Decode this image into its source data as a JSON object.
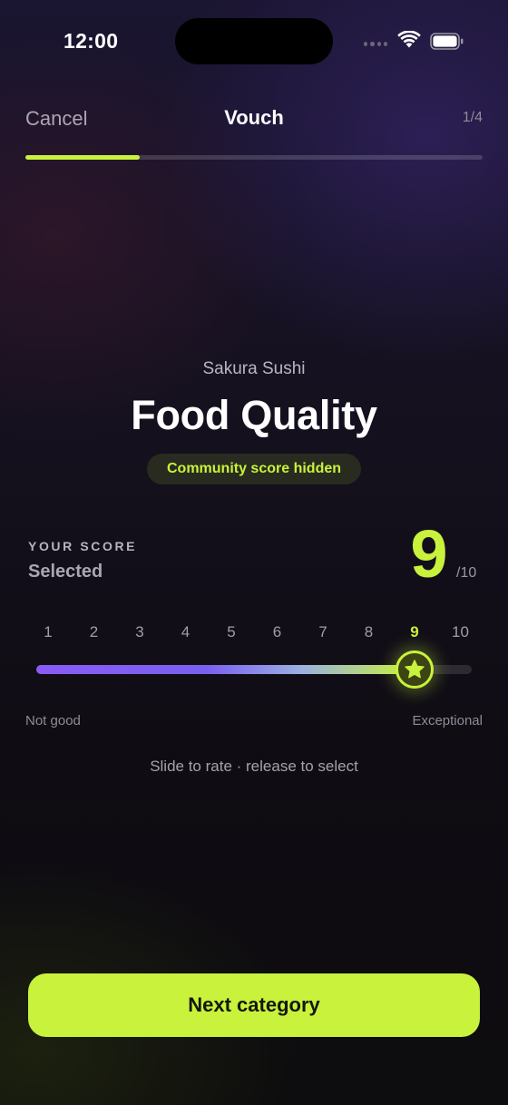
{
  "status_bar": {
    "time": "12:00"
  },
  "nav": {
    "cancel_label": "Cancel",
    "title": "Vouch",
    "step": "1/4",
    "progress": 0.25
  },
  "header": {
    "venue": "Sakura Sushi",
    "category": "Food Quality",
    "community_badge": "Community score hidden"
  },
  "score": {
    "label": "YOUR SCORE",
    "state": "Selected",
    "value": 9,
    "value_text": "9",
    "max_text": "/10",
    "min": 1,
    "max": 10
  },
  "scale": {
    "ticks": [
      "1",
      "2",
      "3",
      "4",
      "5",
      "6",
      "7",
      "8",
      "9",
      "10"
    ],
    "low_label": "Not good",
    "high_label": "Exceptional"
  },
  "hint": "Slide to rate · release to select",
  "cta": {
    "label": "Next category"
  },
  "colors": {
    "accent": "#c8f23c",
    "gradient_start": "#8a5cf5",
    "background": "#0d0b12"
  },
  "icons": {
    "thumb": "star-icon",
    "wifi": "wifi-icon",
    "battery": "battery-icon",
    "signal": "signal-dots-icon"
  }
}
